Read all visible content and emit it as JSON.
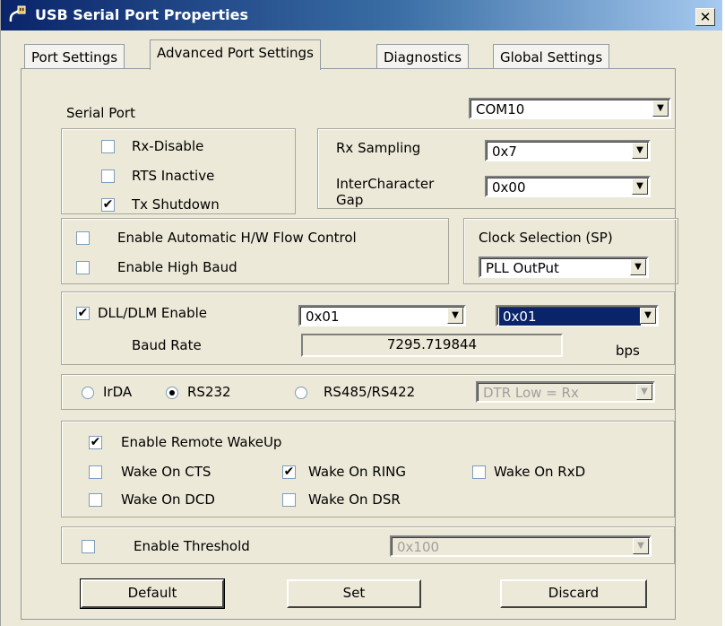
{
  "window": {
    "title": "USB Serial Port Properties",
    "close_glyph": "✕"
  },
  "tabs": [
    {
      "label": "Port Settings",
      "active": false
    },
    {
      "label": "Advanced Port Settings",
      "active": true
    },
    {
      "label": "Diagnostics",
      "active": false
    },
    {
      "label": "Global Settings",
      "active": false
    }
  ],
  "serial_port": {
    "label": "Serial Port",
    "value": "COM10"
  },
  "rx_options": {
    "rx_disable": {
      "label": "Rx-Disable",
      "checked": false
    },
    "rts_inactive": {
      "label": "RTS Inactive",
      "checked": false
    },
    "tx_shutdown": {
      "label": "Tx Shutdown",
      "checked": true
    }
  },
  "sampling": {
    "rx_sampling_label": "Rx Sampling",
    "rx_sampling_value": "0x7",
    "gap_label_1": "InterCharacter",
    "gap_label_2": "Gap",
    "gap_value": "0x00"
  },
  "flow": {
    "auto_hw_label": "Enable Automatic H/W Flow Control",
    "auto_hw_checked": false,
    "high_baud_label": "Enable High Baud",
    "high_baud_checked": false
  },
  "clock": {
    "label": "Clock Selection (SP)",
    "value": "PLL OutPut"
  },
  "dll": {
    "enable_label": "DLL/DLM Enable",
    "enable_checked": true,
    "dll_value": "0x01",
    "dlm_value": "0x01",
    "baud_label": "Baud Rate",
    "baud_value": "7295.719844",
    "baud_unit": "bps"
  },
  "mode": {
    "irda_label": "IrDA",
    "rs232_label": "RS232",
    "rs485_label": "RS485/RS422",
    "selected": "RS232",
    "dtr_value": "DTR Low  = Rx"
  },
  "wakeup": {
    "enable_label": "Enable Remote WakeUp",
    "enable_checked": true,
    "cts_label": "Wake On CTS",
    "cts_checked": false,
    "ring_label": "Wake On RING",
    "ring_checked": true,
    "rxd_label": "Wake On RxD",
    "rxd_checked": false,
    "dcd_label": "Wake On DCD",
    "dcd_checked": false,
    "dsr_label": "Wake On DSR",
    "dsr_checked": false
  },
  "threshold": {
    "label": "Enable Threshold",
    "checked": false,
    "value": "0x100"
  },
  "buttons": {
    "default_label": "Default",
    "set_label": "Set",
    "discard_label": "Discard"
  },
  "glyphs": {
    "check": "✔",
    "arrow": "▼"
  }
}
